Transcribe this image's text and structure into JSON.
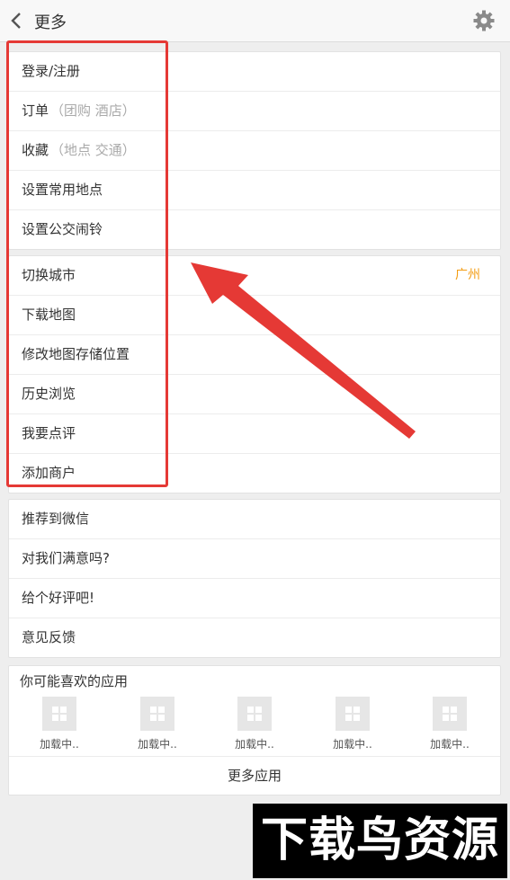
{
  "header": {
    "title": "更多"
  },
  "section1": [
    {
      "label": "登录/注册",
      "hint": ""
    },
    {
      "label": "订单",
      "hint": "（团购  酒店）"
    },
    {
      "label": "收藏",
      "hint": "（地点  交通）"
    },
    {
      "label": "设置常用地点",
      "hint": ""
    },
    {
      "label": "设置公交闹铃",
      "hint": ""
    }
  ],
  "section2": [
    {
      "label": "切换城市",
      "value": "广州"
    },
    {
      "label": "下载地图"
    },
    {
      "label": "修改地图存储位置"
    },
    {
      "label": "历史浏览"
    },
    {
      "label": "我要点评"
    },
    {
      "label": "添加商户"
    }
  ],
  "section3": [
    {
      "label": "推荐到微信"
    },
    {
      "label": "对我们满意吗?"
    },
    {
      "label": "给个好评吧!"
    },
    {
      "label": "意见反馈"
    }
  ],
  "apps": {
    "title": "你可能喜欢的应用",
    "items": [
      {
        "label": "加载中.."
      },
      {
        "label": "加载中.."
      },
      {
        "label": "加载中.."
      },
      {
        "label": "加载中.."
      },
      {
        "label": "加载中.."
      }
    ],
    "more_label": "更多应用"
  },
  "watermark": {
    "text": "下载鸟资源"
  },
  "colors": {
    "highlight": "#e53935",
    "city": "#f39c12"
  }
}
